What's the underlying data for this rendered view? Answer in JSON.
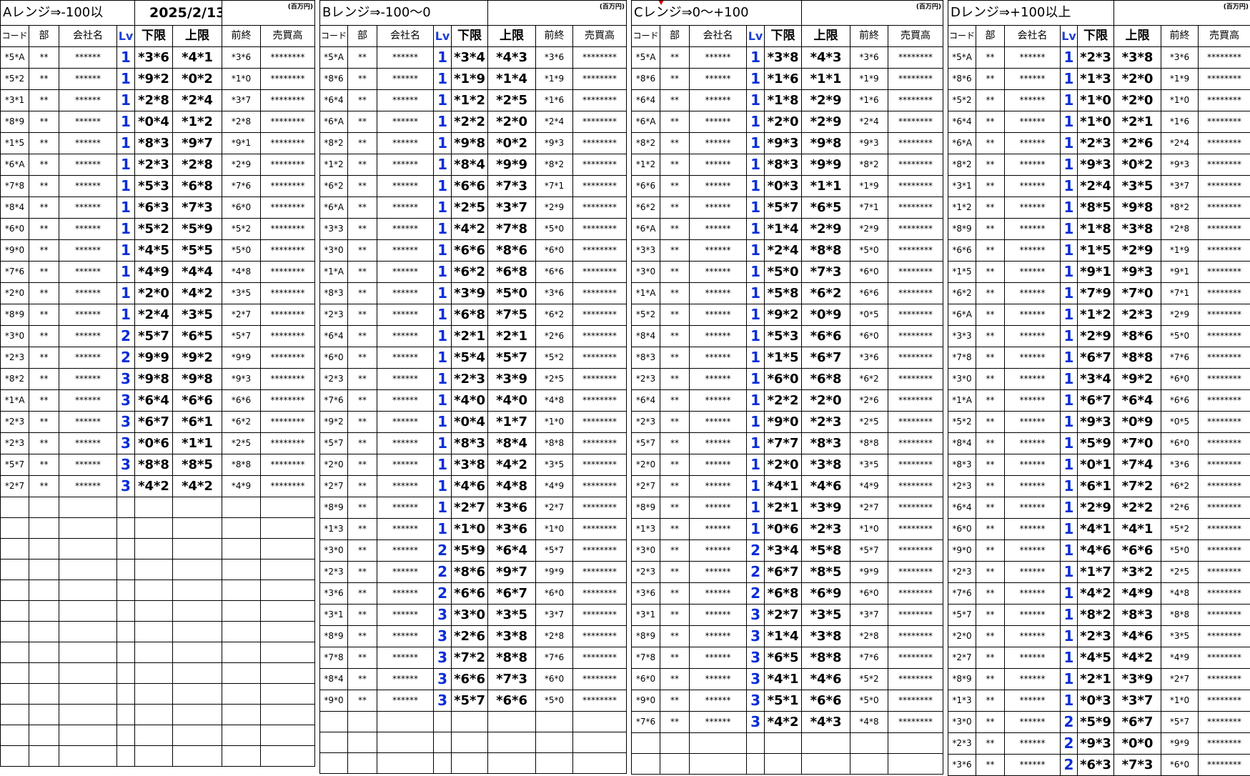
{
  "sheet": {
    "date": "2025/2/13",
    "unit": "(百万円)",
    "headers": {
      "code": "コード",
      "bu": "部",
      "name": "会社名",
      "lv": "Lv",
      "lo": "下限",
      "hi": "上限",
      "pr": "前終",
      "sales": "売買高"
    },
    "masked": {
      "bu": "**",
      "name": "******",
      "sales": "********"
    }
  },
  "sections": [
    {
      "title": "Aレンジ⇒-100以",
      "rows": [
        {
          "code": "*5*A",
          "lv": "1",
          "lo": "*3*6",
          "hi": "*4*1",
          "pr": "*3*6"
        },
        {
          "code": "*5*2",
          "lv": "1",
          "lo": "*9*2",
          "hi": "*0*2",
          "pr": "*1*0"
        },
        {
          "code": "*3*1",
          "lv": "1",
          "lo": "*2*8",
          "hi": "*2*4",
          "pr": "*3*7"
        },
        {
          "code": "*8*9",
          "lv": "1",
          "lo": "*0*4",
          "hi": "*1*2",
          "pr": "*2*8"
        },
        {
          "code": "*1*5",
          "lv": "1",
          "lo": "*8*3",
          "hi": "*9*7",
          "pr": "*9*1"
        },
        {
          "code": "*6*A",
          "lv": "1",
          "lo": "*2*3",
          "hi": "*2*8",
          "pr": "*2*9"
        },
        {
          "code": "*7*8",
          "lv": "1",
          "lo": "*5*3",
          "hi": "*6*8",
          "pr": "*7*6"
        },
        {
          "code": "*8*4",
          "lv": "1",
          "lo": "*6*3",
          "hi": "*7*3",
          "pr": "*6*0"
        },
        {
          "code": "*6*0",
          "lv": "1",
          "lo": "*5*2",
          "hi": "*5*9",
          "pr": "*5*2"
        },
        {
          "code": "*9*0",
          "lv": "1",
          "lo": "*4*5",
          "hi": "*5*5",
          "pr": "*5*0"
        },
        {
          "code": "*7*6",
          "lv": "1",
          "lo": "*4*9",
          "hi": "*4*4",
          "pr": "*4*8"
        },
        {
          "code": "*2*0",
          "lv": "1",
          "lo": "*2*0",
          "hi": "*4*2",
          "pr": "*3*5"
        },
        {
          "code": "*8*9",
          "lv": "1",
          "lo": "*2*4",
          "hi": "*3*5",
          "pr": "*2*7"
        },
        {
          "code": "*3*0",
          "lv": "2",
          "lo": "*5*7",
          "hi": "*6*5",
          "pr": "*5*7"
        },
        {
          "code": "*2*3",
          "lv": "2",
          "lo": "*9*9",
          "hi": "*9*2",
          "pr": "*9*9"
        },
        {
          "code": "*8*2",
          "lv": "3",
          "lo": "*9*8",
          "hi": "*9*8",
          "pr": "*9*3"
        },
        {
          "code": "*1*A",
          "lv": "3",
          "lo": "*6*4",
          "hi": "*6*6",
          "pr": "*6*6"
        },
        {
          "code": "*2*3",
          "lv": "3",
          "lo": "*6*7",
          "hi": "*6*1",
          "pr": "*6*2"
        },
        {
          "code": "*2*3",
          "lv": "3",
          "lo": "*0*6",
          "hi": "*1*1",
          "pr": "*2*5"
        },
        {
          "code": "*5*7",
          "lv": "3",
          "lo": "*8*8",
          "hi": "*8*5",
          "pr": "*8*8"
        },
        {
          "code": "*2*7",
          "lv": "3",
          "lo": "*4*2",
          "hi": "*4*2",
          "pr": "*4*9"
        }
      ]
    },
    {
      "title": "Bレンジ⇒-100～0",
      "rows": [
        {
          "code": "*5*A",
          "lv": "1",
          "lo": "*3*4",
          "hi": "*4*3",
          "pr": "*3*6"
        },
        {
          "code": "*8*6",
          "lv": "1",
          "lo": "*1*9",
          "hi": "*1*4",
          "pr": "*1*9"
        },
        {
          "code": "*6*4",
          "lv": "1",
          "lo": "*1*2",
          "hi": "*2*5",
          "pr": "*1*6"
        },
        {
          "code": "*6*A",
          "lv": "1",
          "lo": "*2*2",
          "hi": "*2*0",
          "pr": "*2*4"
        },
        {
          "code": "*8*2",
          "lv": "1",
          "lo": "*9*8",
          "hi": "*0*2",
          "pr": "*9*3"
        },
        {
          "code": "*1*2",
          "lv": "1",
          "lo": "*8*4",
          "hi": "*9*9",
          "pr": "*8*2"
        },
        {
          "code": "*6*2",
          "lv": "1",
          "lo": "*6*6",
          "hi": "*7*3",
          "pr": "*7*1"
        },
        {
          "code": "*6*A",
          "lv": "1",
          "lo": "*2*5",
          "hi": "*3*7",
          "pr": "*2*9"
        },
        {
          "code": "*3*3",
          "lv": "1",
          "lo": "*4*2",
          "hi": "*7*8",
          "pr": "*5*0"
        },
        {
          "code": "*3*0",
          "lv": "1",
          "lo": "*6*6",
          "hi": "*8*6",
          "pr": "*6*0"
        },
        {
          "code": "*1*A",
          "lv": "1",
          "lo": "*6*2",
          "hi": "*6*8",
          "pr": "*6*6"
        },
        {
          "code": "*8*3",
          "lv": "1",
          "lo": "*3*9",
          "hi": "*5*0",
          "pr": "*3*6"
        },
        {
          "code": "*2*3",
          "lv": "1",
          "lo": "*6*8",
          "hi": "*7*5",
          "pr": "*6*2"
        },
        {
          "code": "*6*4",
          "lv": "1",
          "lo": "*2*1",
          "hi": "*2*1",
          "pr": "*2*6"
        },
        {
          "code": "*6*0",
          "lv": "1",
          "lo": "*5*4",
          "hi": "*5*7",
          "pr": "*5*2"
        },
        {
          "code": "*2*3",
          "lv": "1",
          "lo": "*2*3",
          "hi": "*3*9",
          "pr": "*2*5"
        },
        {
          "code": "*7*6",
          "lv": "1",
          "lo": "*4*0",
          "hi": "*4*0",
          "pr": "*4*8"
        },
        {
          "code": "*9*2",
          "lv": "1",
          "lo": "*0*4",
          "hi": "*1*7",
          "pr": "*1*0"
        },
        {
          "code": "*5*7",
          "lv": "1",
          "lo": "*8*3",
          "hi": "*8*4",
          "pr": "*8*8"
        },
        {
          "code": "*2*0",
          "lv": "1",
          "lo": "*3*8",
          "hi": "*4*2",
          "pr": "*3*5"
        },
        {
          "code": "*2*7",
          "lv": "1",
          "lo": "*4*6",
          "hi": "*4*8",
          "pr": "*4*9"
        },
        {
          "code": "*8*9",
          "lv": "1",
          "lo": "*2*7",
          "hi": "*3*6",
          "pr": "*2*7"
        },
        {
          "code": "*1*3",
          "lv": "1",
          "lo": "*1*0",
          "hi": "*3*6",
          "pr": "*1*0"
        },
        {
          "code": "*3*0",
          "lv": "2",
          "lo": "*5*9",
          "hi": "*6*4",
          "pr": "*5*7"
        },
        {
          "code": "*2*3",
          "lv": "2",
          "lo": "*8*6",
          "hi": "*9*7",
          "pr": "*9*9"
        },
        {
          "code": "*3*6",
          "lv": "2",
          "lo": "*6*6",
          "hi": "*6*7",
          "pr": "*6*0"
        },
        {
          "code": "*3*1",
          "lv": "3",
          "lo": "*3*0",
          "hi": "*3*5",
          "pr": "*3*7"
        },
        {
          "code": "*8*9",
          "lv": "3",
          "lo": "*2*6",
          "hi": "*3*8",
          "pr": "*2*8"
        },
        {
          "code": "*7*8",
          "lv": "3",
          "lo": "*7*2",
          "hi": "*8*8",
          "pr": "*7*6"
        },
        {
          "code": "*8*4",
          "lv": "3",
          "lo": "*6*6",
          "hi": "*7*3",
          "pr": "*6*0"
        },
        {
          "code": "*9*0",
          "lv": "3",
          "lo": "*5*7",
          "hi": "*6*6",
          "pr": "*5*0"
        }
      ]
    },
    {
      "title": "Cレンジ⇒0～+100",
      "rows": [
        {
          "code": "*5*A",
          "lv": "1",
          "lo": "*3*8",
          "hi": "*4*3",
          "pr": "*3*6"
        },
        {
          "code": "*8*6",
          "lv": "1",
          "lo": "*1*6",
          "hi": "*1*1",
          "pr": "*1*9"
        },
        {
          "code": "*6*4",
          "lv": "1",
          "lo": "*1*8",
          "hi": "*2*9",
          "pr": "*1*6"
        },
        {
          "code": "*6*A",
          "lv": "1",
          "lo": "*2*0",
          "hi": "*2*9",
          "pr": "*2*4"
        },
        {
          "code": "*8*2",
          "lv": "1",
          "lo": "*9*3",
          "hi": "*9*8",
          "pr": "*9*3"
        },
        {
          "code": "*1*2",
          "lv": "1",
          "lo": "*8*3",
          "hi": "*9*9",
          "pr": "*8*2"
        },
        {
          "code": "*6*6",
          "lv": "1",
          "lo": "*0*3",
          "hi": "*1*1",
          "pr": "*1*9"
        },
        {
          "code": "*6*2",
          "lv": "1",
          "lo": "*5*7",
          "hi": "*6*5",
          "pr": "*7*1"
        },
        {
          "code": "*6*A",
          "lv": "1",
          "lo": "*1*4",
          "hi": "*2*9",
          "pr": "*2*9"
        },
        {
          "code": "*3*3",
          "lv": "1",
          "lo": "*2*4",
          "hi": "*8*8",
          "pr": "*5*0"
        },
        {
          "code": "*3*0",
          "lv": "1",
          "lo": "*5*0",
          "hi": "*7*3",
          "pr": "*6*0"
        },
        {
          "code": "*1*A",
          "lv": "1",
          "lo": "*5*8",
          "hi": "*6*2",
          "pr": "*6*6"
        },
        {
          "code": "*5*2",
          "lv": "1",
          "lo": "*9*2",
          "hi": "*0*9",
          "pr": "*0*5"
        },
        {
          "code": "*8*4",
          "lv": "1",
          "lo": "*5*3",
          "hi": "*6*6",
          "pr": "*6*0"
        },
        {
          "code": "*8*3",
          "lv": "1",
          "lo": "*1*5",
          "hi": "*6*7",
          "pr": "*3*6"
        },
        {
          "code": "*2*3",
          "lv": "1",
          "lo": "*6*0",
          "hi": "*6*8",
          "pr": "*6*2"
        },
        {
          "code": "*6*4",
          "lv": "1",
          "lo": "*2*2",
          "hi": "*2*0",
          "pr": "*2*6"
        },
        {
          "code": "*2*3",
          "lv": "1",
          "lo": "*9*0",
          "hi": "*2*3",
          "pr": "*2*5"
        },
        {
          "code": "*5*7",
          "lv": "1",
          "lo": "*7*7",
          "hi": "*8*3",
          "pr": "*8*8"
        },
        {
          "code": "*2*0",
          "lv": "1",
          "lo": "*2*0",
          "hi": "*3*8",
          "pr": "*3*5"
        },
        {
          "code": "*2*7",
          "lv": "1",
          "lo": "*4*1",
          "hi": "*4*6",
          "pr": "*4*9"
        },
        {
          "code": "*8*9",
          "lv": "1",
          "lo": "*2*1",
          "hi": "*3*9",
          "pr": "*2*7"
        },
        {
          "code": "*1*3",
          "lv": "1",
          "lo": "*0*6",
          "hi": "*2*3",
          "pr": "*1*0"
        },
        {
          "code": "*3*0",
          "lv": "2",
          "lo": "*3*4",
          "hi": "*5*8",
          "pr": "*5*7"
        },
        {
          "code": "*2*3",
          "lv": "2",
          "lo": "*6*7",
          "hi": "*8*5",
          "pr": "*9*9"
        },
        {
          "code": "*3*6",
          "lv": "2",
          "lo": "*6*8",
          "hi": "*6*9",
          "pr": "*6*0"
        },
        {
          "code": "*3*1",
          "lv": "3",
          "lo": "*2*7",
          "hi": "*3*5",
          "pr": "*3*7"
        },
        {
          "code": "*8*9",
          "lv": "3",
          "lo": "*1*4",
          "hi": "*3*8",
          "pr": "*2*8"
        },
        {
          "code": "*7*8",
          "lv": "3",
          "lo": "*6*5",
          "hi": "*8*8",
          "pr": "*7*6"
        },
        {
          "code": "*6*0",
          "lv": "3",
          "lo": "*4*1",
          "hi": "*4*6",
          "pr": "*5*2"
        },
        {
          "code": "*9*0",
          "lv": "3",
          "lo": "*5*1",
          "hi": "*6*6",
          "pr": "*5*0"
        },
        {
          "code": "*7*6",
          "lv": "3",
          "lo": "*4*2",
          "hi": "*4*3",
          "pr": "*4*8"
        }
      ]
    },
    {
      "title": "Dレンジ⇒+100以上",
      "rows": [
        {
          "code": "*5*A",
          "lv": "1",
          "lo": "*2*3",
          "hi": "*3*8",
          "pr": "*3*6"
        },
        {
          "code": "*8*6",
          "lv": "1",
          "lo": "*1*3",
          "hi": "*2*0",
          "pr": "*1*9"
        },
        {
          "code": "*5*2",
          "lv": "1",
          "lo": "*1*0",
          "hi": "*2*0",
          "pr": "*1*0"
        },
        {
          "code": "*6*4",
          "lv": "1",
          "lo": "*1*0",
          "hi": "*2*1",
          "pr": "*1*6"
        },
        {
          "code": "*6*A",
          "lv": "1",
          "lo": "*2*3",
          "hi": "*2*6",
          "pr": "*2*4"
        },
        {
          "code": "*8*2",
          "lv": "1",
          "lo": "*9*3",
          "hi": "*0*2",
          "pr": "*9*3"
        },
        {
          "code": "*3*1",
          "lv": "1",
          "lo": "*2*4",
          "hi": "*3*5",
          "pr": "*3*7"
        },
        {
          "code": "*1*2",
          "lv": "1",
          "lo": "*8*5",
          "hi": "*9*8",
          "pr": "*8*2"
        },
        {
          "code": "*8*9",
          "lv": "1",
          "lo": "*1*8",
          "hi": "*3*8",
          "pr": "*2*8"
        },
        {
          "code": "*6*6",
          "lv": "1",
          "lo": "*1*5",
          "hi": "*2*9",
          "pr": "*1*9"
        },
        {
          "code": "*1*5",
          "lv": "1",
          "lo": "*9*1",
          "hi": "*9*3",
          "pr": "*9*1"
        },
        {
          "code": "*6*2",
          "lv": "1",
          "lo": "*7*9",
          "hi": "*7*0",
          "pr": "*7*1"
        },
        {
          "code": "*6*A",
          "lv": "1",
          "lo": "*1*2",
          "hi": "*2*3",
          "pr": "*2*9"
        },
        {
          "code": "*3*3",
          "lv": "1",
          "lo": "*2*9",
          "hi": "*8*6",
          "pr": "*5*0"
        },
        {
          "code": "*7*8",
          "lv": "1",
          "lo": "*6*7",
          "hi": "*8*8",
          "pr": "*7*6"
        },
        {
          "code": "*3*0",
          "lv": "1",
          "lo": "*3*4",
          "hi": "*9*2",
          "pr": "*6*0"
        },
        {
          "code": "*1*A",
          "lv": "1",
          "lo": "*6*7",
          "hi": "*6*4",
          "pr": "*6*6"
        },
        {
          "code": "*5*2",
          "lv": "1",
          "lo": "*9*3",
          "hi": "*0*9",
          "pr": "*0*5"
        },
        {
          "code": "*8*4",
          "lv": "1",
          "lo": "*5*9",
          "hi": "*7*0",
          "pr": "*6*0"
        },
        {
          "code": "*8*3",
          "lv": "1",
          "lo": "*0*1",
          "hi": "*7*4",
          "pr": "*3*6"
        },
        {
          "code": "*2*3",
          "lv": "1",
          "lo": "*6*1",
          "hi": "*7*2",
          "pr": "*6*2"
        },
        {
          "code": "*6*4",
          "lv": "1",
          "lo": "*2*9",
          "hi": "*2*2",
          "pr": "*2*6"
        },
        {
          "code": "*6*0",
          "lv": "1",
          "lo": "*4*1",
          "hi": "*4*1",
          "pr": "*5*2"
        },
        {
          "code": "*9*0",
          "lv": "1",
          "lo": "*4*6",
          "hi": "*6*6",
          "pr": "*5*0"
        },
        {
          "code": "*2*3",
          "lv": "1",
          "lo": "*1*7",
          "hi": "*3*2",
          "pr": "*2*5"
        },
        {
          "code": "*7*6",
          "lv": "1",
          "lo": "*4*2",
          "hi": "*4*9",
          "pr": "*4*8"
        },
        {
          "code": "*5*7",
          "lv": "1",
          "lo": "*8*2",
          "hi": "*8*3",
          "pr": "*8*8"
        },
        {
          "code": "*2*0",
          "lv": "1",
          "lo": "*2*3",
          "hi": "*4*6",
          "pr": "*3*5"
        },
        {
          "code": "*2*7",
          "lv": "1",
          "lo": "*4*5",
          "hi": "*4*2",
          "pr": "*4*9"
        },
        {
          "code": "*8*9",
          "lv": "1",
          "lo": "*2*1",
          "hi": "*3*9",
          "pr": "*2*7"
        },
        {
          "code": "*1*3",
          "lv": "1",
          "lo": "*0*3",
          "hi": "*3*7",
          "pr": "*1*0"
        },
        {
          "code": "*3*0",
          "lv": "2",
          "lo": "*5*9",
          "hi": "*6*7",
          "pr": "*5*7"
        },
        {
          "code": "*2*3",
          "lv": "2",
          "lo": "*9*3",
          "hi": "*0*0",
          "pr": "*9*9"
        },
        {
          "code": "*3*6",
          "lv": "2",
          "lo": "*6*3",
          "hi": "*7*3",
          "pr": "*6*0"
        }
      ]
    }
  ]
}
